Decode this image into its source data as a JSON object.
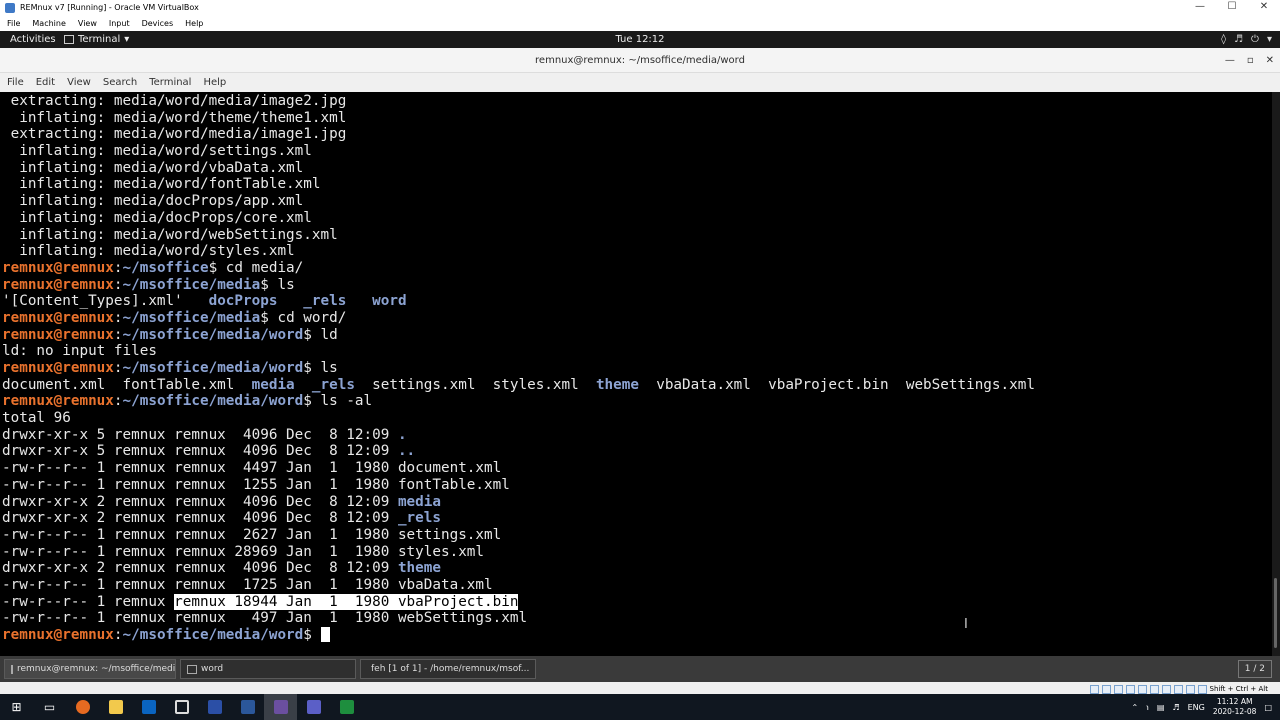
{
  "vbox": {
    "title": "REMnux v7 [Running] - Oracle VM VirtualBox",
    "menu": [
      "File",
      "Machine",
      "View",
      "Input",
      "Devices",
      "Help"
    ],
    "status_text": "Shift + Ctrl + Alt"
  },
  "gnome": {
    "activities": "Activities",
    "app_name": "Terminal",
    "clock": "Tue 12:12"
  },
  "terminal": {
    "title": "remnux@remnux: ~/msoffice/media/word",
    "menu": [
      "File",
      "Edit",
      "View",
      "Search",
      "Terminal",
      "Help"
    ],
    "lines": [
      [
        {
          "t": " extracting: media/word/media/image2.jpg"
        }
      ],
      [
        {
          "t": "  inflating: media/word/theme/theme1.xml"
        }
      ],
      [
        {
          "t": " extracting: media/word/media/image1.jpg"
        }
      ],
      [
        {
          "t": "  inflating: media/word/settings.xml"
        }
      ],
      [
        {
          "t": "  inflating: media/word/vbaData.xml"
        }
      ],
      [
        {
          "t": "  inflating: media/word/fontTable.xml"
        }
      ],
      [
        {
          "t": "  inflating: media/docProps/app.xml"
        }
      ],
      [
        {
          "t": "  inflating: media/docProps/core.xml"
        }
      ],
      [
        {
          "t": "  inflating: media/word/webSettings.xml"
        }
      ],
      [
        {
          "t": "  inflating: media/word/styles.xml"
        }
      ],
      [
        {
          "t": "remnux@remnux",
          "c": "u"
        },
        {
          "t": ":"
        },
        {
          "t": "~/msoffice",
          "c": "p"
        },
        {
          "t": "$ cd media/"
        }
      ],
      [
        {
          "t": "remnux@remnux",
          "c": "u"
        },
        {
          "t": ":"
        },
        {
          "t": "~/msoffice/media",
          "c": "p"
        },
        {
          "t": "$ ls"
        }
      ],
      [
        {
          "t": "'[Content_Types].xml'   "
        },
        {
          "t": "docProps",
          "c": "d"
        },
        {
          "t": "   "
        },
        {
          "t": "_rels",
          "c": "d"
        },
        {
          "t": "   "
        },
        {
          "t": "word",
          "c": "d"
        }
      ],
      [
        {
          "t": "remnux@remnux",
          "c": "u"
        },
        {
          "t": ":"
        },
        {
          "t": "~/msoffice/media",
          "c": "p"
        },
        {
          "t": "$ cd word/"
        }
      ],
      [
        {
          "t": "remnux@remnux",
          "c": "u"
        },
        {
          "t": ":"
        },
        {
          "t": "~/msoffice/media/word",
          "c": "p"
        },
        {
          "t": "$ ld"
        }
      ],
      [
        {
          "t": "ld: no input files"
        }
      ],
      [
        {
          "t": "remnux@remnux",
          "c": "u"
        },
        {
          "t": ":"
        },
        {
          "t": "~/msoffice/media/word",
          "c": "p"
        },
        {
          "t": "$ ls"
        }
      ],
      [
        {
          "t": "document.xml  fontTable.xml  "
        },
        {
          "t": "media",
          "c": "d"
        },
        {
          "t": "  "
        },
        {
          "t": "_rels",
          "c": "d"
        },
        {
          "t": "  settings.xml  styles.xml  "
        },
        {
          "t": "theme",
          "c": "d"
        },
        {
          "t": "  vbaData.xml  vbaProject.bin  webSettings.xml"
        }
      ],
      [
        {
          "t": "remnux@remnux",
          "c": "u"
        },
        {
          "t": ":"
        },
        {
          "t": "~/msoffice/media/word",
          "c": "p"
        },
        {
          "t": "$ ls -al"
        }
      ],
      [
        {
          "t": "total 96"
        }
      ],
      [
        {
          "t": "drwxr-xr-x 5 remnux remnux  4096 Dec  8 12:09 "
        },
        {
          "t": ".",
          "c": "d"
        }
      ],
      [
        {
          "t": "drwxr-xr-x 5 remnux remnux  4096 Dec  8 12:09 "
        },
        {
          "t": "..",
          "c": "d"
        }
      ],
      [
        {
          "t": "-rw-r--r-- 1 remnux remnux  4497 Jan  1  1980 document.xml"
        }
      ],
      [
        {
          "t": "-rw-r--r-- 1 remnux remnux  1255 Jan  1  1980 fontTable.xml"
        }
      ],
      [
        {
          "t": "drwxr-xr-x 2 remnux remnux  4096 Dec  8 12:09 "
        },
        {
          "t": "media",
          "c": "d"
        }
      ],
      [
        {
          "t": "drwxr-xr-x 2 remnux remnux  4096 Dec  8 12:09 "
        },
        {
          "t": "_rels",
          "c": "d"
        }
      ],
      [
        {
          "t": "-rw-r--r-- 1 remnux remnux  2627 Jan  1  1980 settings.xml"
        }
      ],
      [
        {
          "t": "-rw-r--r-- 1 remnux remnux 28969 Jan  1  1980 styles.xml"
        }
      ],
      [
        {
          "t": "drwxr-xr-x 2 remnux remnux  4096 Dec  8 12:09 "
        },
        {
          "t": "theme",
          "c": "d"
        }
      ],
      [
        {
          "t": "-rw-r--r-- 1 remnux remnux  1725 Jan  1  1980 vbaData.xml"
        }
      ],
      [
        {
          "t": "-rw-r--r-- 1 remnux "
        },
        {
          "t": "remnux 18944 Jan  1  1980 vbaProject.bin",
          "c": "hl"
        }
      ],
      [
        {
          "t": "-rw-r--r-- 1 remnux remnux   497 Jan  1  1980 webSettings.xml"
        }
      ],
      [
        {
          "t": "remnux@remnux",
          "c": "u"
        },
        {
          "t": ":"
        },
        {
          "t": "~/msoffice/media/word",
          "c": "p"
        },
        {
          "t": "$ "
        },
        {
          "t": "",
          "c": "cursor"
        }
      ]
    ]
  },
  "taskbar": {
    "tasks": [
      {
        "label": "remnux@remnux: ~/msoffice/medi...",
        "icon": "terminal-icon",
        "active": true
      },
      {
        "label": "word",
        "icon": "folder-icon",
        "active": false
      },
      {
        "label": "feh [1 of 1] - /home/remnux/msof...",
        "icon": "image-viewer-icon",
        "active": false
      }
    ],
    "pager": "1 / 2"
  },
  "windows": {
    "language": "ENG",
    "time": "11:12 AM",
    "date": "2020-12-08"
  }
}
